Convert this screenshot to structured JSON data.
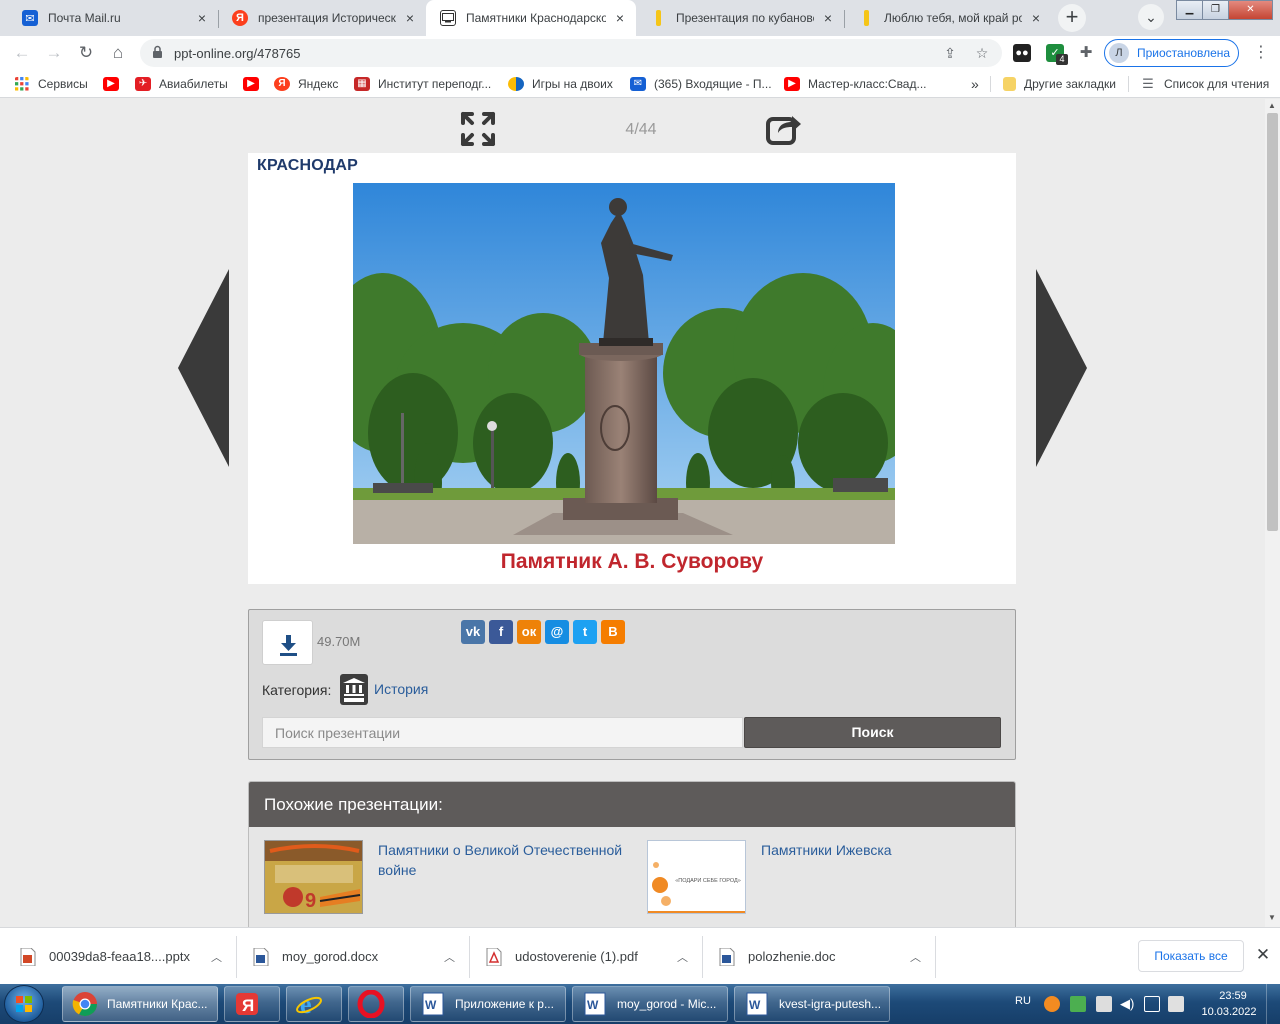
{
  "tabs": [
    {
      "title": "Почта Mail.ru",
      "icon": "mail-icon",
      "color": "#1560d4"
    },
    {
      "title": "презентация Исторически",
      "icon": "yandex-icon",
      "color": "#fc3f1d"
    },
    {
      "title": "Памятники Краснодарско",
      "icon": "ppt-online-icon",
      "color": "#333333"
    },
    {
      "title": "Презентация по кубанове",
      "icon": "yellow-page-icon",
      "color": "#f5c518"
    },
    {
      "title": "Люблю тебя, мой край ро",
      "icon": "yellow-page-icon",
      "color": "#f5c518"
    }
  ],
  "address": {
    "url": "ppt-online.org/478765"
  },
  "extensions": {
    "badge": "4"
  },
  "profile": {
    "initial": "Л",
    "status": "Приостановлена"
  },
  "bookmarks": [
    {
      "label": "Сервисы",
      "icon": "apps-grid-icon"
    },
    {
      "label": "",
      "icon": "youtube-icon"
    },
    {
      "label": "Авиабилеты",
      "icon": "aviatickets-icon"
    },
    {
      "label": "",
      "icon": "youtube-icon"
    },
    {
      "label": "Яндекс",
      "icon": "yandex-icon"
    },
    {
      "label": "Институт переподг...",
      "icon": "institute-icon"
    },
    {
      "label": "Игры на двоих",
      "icon": "games-icon"
    },
    {
      "label": "(365) Входящие - П...",
      "icon": "mail-icon"
    },
    {
      "label": "Мастер-класс:Свад...",
      "icon": "youtube-icon"
    }
  ],
  "bookmarks_more": "»",
  "bookmarks_other": "Другие закладки",
  "bookmarks_reading": "Список для чтения",
  "viewer": {
    "counter": "4/44"
  },
  "slide": {
    "city": "КРАСНОДАР",
    "caption": "Памятник А. В. Суворову"
  },
  "info": {
    "file_size": "49.70M",
    "category_label": "Категория:",
    "category": "История",
    "search_placeholder": "Поиск презентации",
    "search_button": "Поиск",
    "social": [
      "vk-icon",
      "facebook-icon",
      "odnoklassniki-icon",
      "moimir-icon",
      "twitter-icon",
      "blogger-icon"
    ]
  },
  "similar": {
    "heading": "Похожие презентации:",
    "items": [
      {
        "title": "Памятники о Великой Отечественной войне"
      },
      {
        "title": "Памятники Ижевска",
        "thumb_text": "«ПОДАРИ СЕБЕ ГОРОД»"
      }
    ]
  },
  "downloads": [
    {
      "name": "00039da8-feaa18....pptx",
      "icon": "pptx-file-icon"
    },
    {
      "name": "moy_gorod.docx",
      "icon": "word-file-icon"
    },
    {
      "name": "udostoverenie (1).pdf",
      "icon": "pdf-file-icon"
    },
    {
      "name": "polozhenie.doc",
      "icon": "word-file-icon"
    }
  ],
  "downloads_show_all": "Показать все",
  "taskbar": {
    "items": [
      {
        "label": "Памятники Крас...",
        "icon": "chrome-icon"
      },
      {
        "label": "",
        "icon": "yandex-browser-icon"
      },
      {
        "label": "",
        "icon": "internet-explorer-icon"
      },
      {
        "label": "",
        "icon": "opera-icon"
      },
      {
        "label": "Приложение к р...",
        "icon": "word-icon"
      },
      {
        "label": "moy_gorod - Mic...",
        "icon": "word-icon"
      },
      {
        "label": "kvest-igra-putesh...",
        "icon": "word-icon"
      }
    ],
    "lang": "RU",
    "time": "23:59",
    "date": "10.03.2022"
  },
  "colors": {
    "accent": "#1a73e8",
    "caption": "#c0262d",
    "city": "#1f3a6b",
    "panel_dark": "#5e5b5a",
    "link": "#2a5d9b"
  }
}
